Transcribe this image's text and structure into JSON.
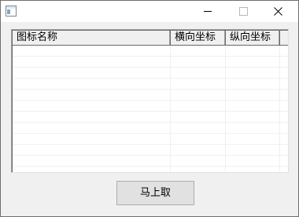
{
  "window": {
    "minimize_icon": "minimize-icon",
    "maximize_icon": "maximize-icon",
    "close_icon": "close-icon"
  },
  "list": {
    "columns": [
      "图标名称",
      "横向坐标",
      "纵向坐标"
    ],
    "rows": []
  },
  "actions": {
    "primary_label": "马上取"
  }
}
